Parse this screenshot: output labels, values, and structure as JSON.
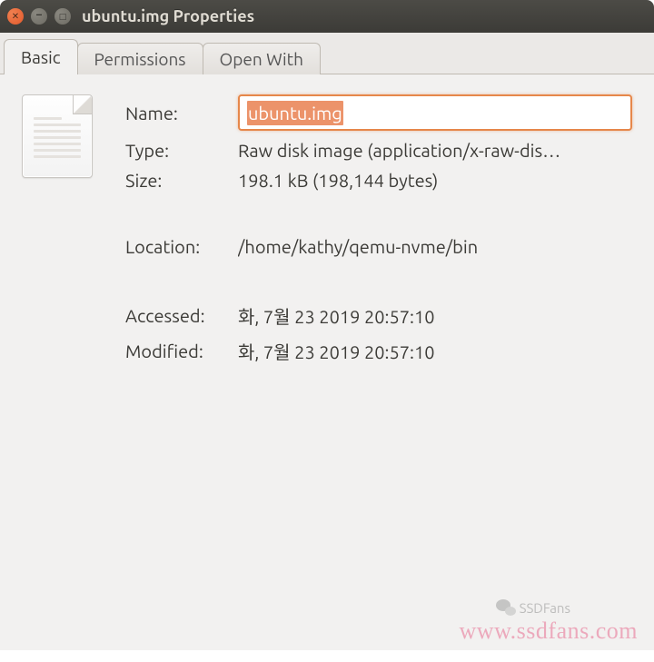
{
  "window": {
    "title": "ubuntu.img Properties"
  },
  "tabs": {
    "basic": "Basic",
    "permissions": "Permissions",
    "open_with": "Open With"
  },
  "labels": {
    "name": "Name:",
    "type": "Type:",
    "size": "Size:",
    "location": "Location:",
    "accessed": "Accessed:",
    "modified": "Modified:"
  },
  "values": {
    "name": "ubuntu.img",
    "type": "Raw disk image (application/x-raw-dis…",
    "size": "198.1 kB (198,144 bytes)",
    "location": "/home/kathy/qemu-nvme/bin",
    "accessed": "화,  7월 23 2019 20:57:10",
    "modified": "화,  7월 23 2019 20:57:10"
  },
  "watermark": {
    "url": "www.ssdfans.com",
    "brand": "SSDFans"
  }
}
